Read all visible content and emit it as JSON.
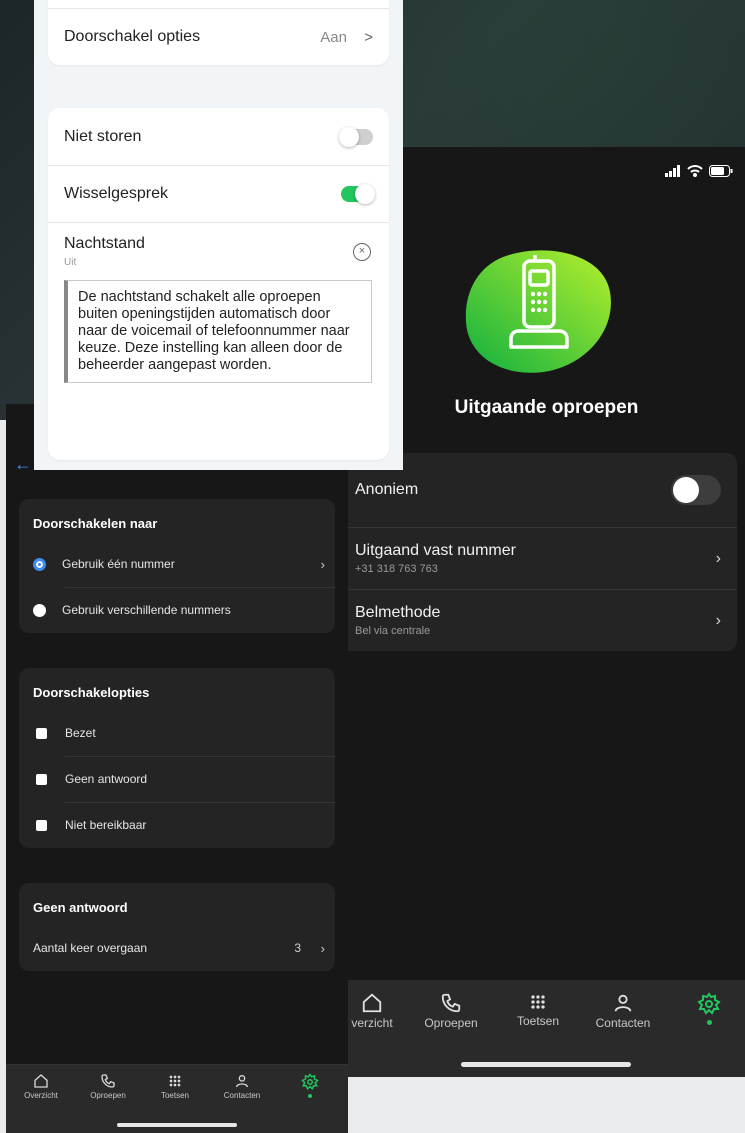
{
  "light_panel": {
    "forward_options_label": "Doorschakel opties",
    "forward_options_value": "Aan",
    "dnd_label": "Niet storen",
    "call_waiting_label": "Wisselgesprek",
    "night_mode_label": "Nachtstand",
    "night_mode_status": "Uit",
    "night_mode_description": "De nachtstand schakelt alle oproepen buiten openingstijden automatisch door naar de voicemail of telefoonnummer naar keuze. Deze instelling kan alleen door de beheerder aangepast worden.",
    "chevron": ">"
  },
  "left_phone": {
    "forward_to": {
      "title": "Doorschakelen naar",
      "options": [
        "Gebruik één nummer",
        "Gebruik verschillende nummers"
      ]
    },
    "forward_options": {
      "title": "Doorschakelopties",
      "options": [
        "Bezet",
        "Geen antwoord",
        "Niet bereikbaar"
      ]
    },
    "no_answer": {
      "title": "Geen antwoord",
      "rings_label": "Aantal keer overgaan",
      "rings_value": "3"
    },
    "tabs": [
      "Overzicht",
      "Oproepen",
      "Toetsen",
      "Contacten"
    ]
  },
  "right_phone": {
    "title": "Uitgaande oproepen",
    "anonymous_label": "Anoniem",
    "fixed_number_label": "Uitgaand vast nummer",
    "fixed_number_value": "+31 318 763 763",
    "call_method_label": "Belmethode",
    "call_method_value": "Bel via centrale",
    "tabs": [
      "verzicht",
      "Oproepen",
      "Toetsen",
      "Contacten"
    ]
  },
  "colors": {
    "accent_green": "#22c55e",
    "accent_blue": "#3d8cf0",
    "dark_bg": "#171717",
    "dark_card": "#242424"
  },
  "icons": [
    "home-icon",
    "phone-icon",
    "keypad-icon",
    "contact-icon",
    "settings-gear-icon",
    "back-arrow-icon",
    "chevron-right-icon",
    "close-circle-icon",
    "handset-icon",
    "signal-icon",
    "wifi-icon",
    "battery-icon"
  ]
}
